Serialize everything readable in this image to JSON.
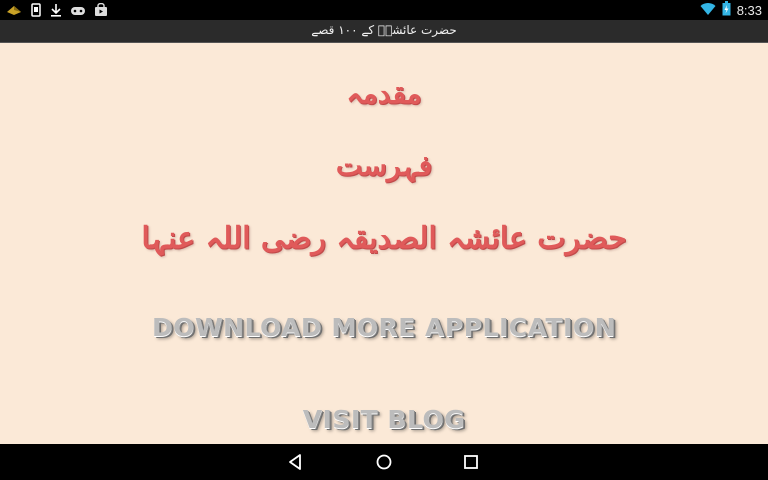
{
  "status_bar": {
    "time": "8:33",
    "left_icons": [
      "notification-icon",
      "phone-icon",
      "download-icon",
      "game-controller-icon",
      "shopping-bag-icon"
    ],
    "right_icons": [
      "wifi-icon",
      "battery-icon"
    ]
  },
  "app_bar": {
    "title": "حضرت عائشہؓ کے ۱۰۰ قصے"
  },
  "menu": {
    "intro": "مقدمہ",
    "index": "فہرست",
    "biography": "حضرت عائشہ الصدیقہ رضی اللہ عنہا"
  },
  "links": {
    "download_more": "DOWNLOAD MORE APPLICATION",
    "visit_blog": "VISIT BLOG"
  },
  "nav_bar": {
    "buttons": [
      "back-icon",
      "home-icon",
      "recents-icon"
    ]
  },
  "colors": {
    "background": "#fbe9d7",
    "menu_text": "#e05a5a",
    "metal_text": "#bcbcbc",
    "app_bar": "#2b2b2b"
  }
}
